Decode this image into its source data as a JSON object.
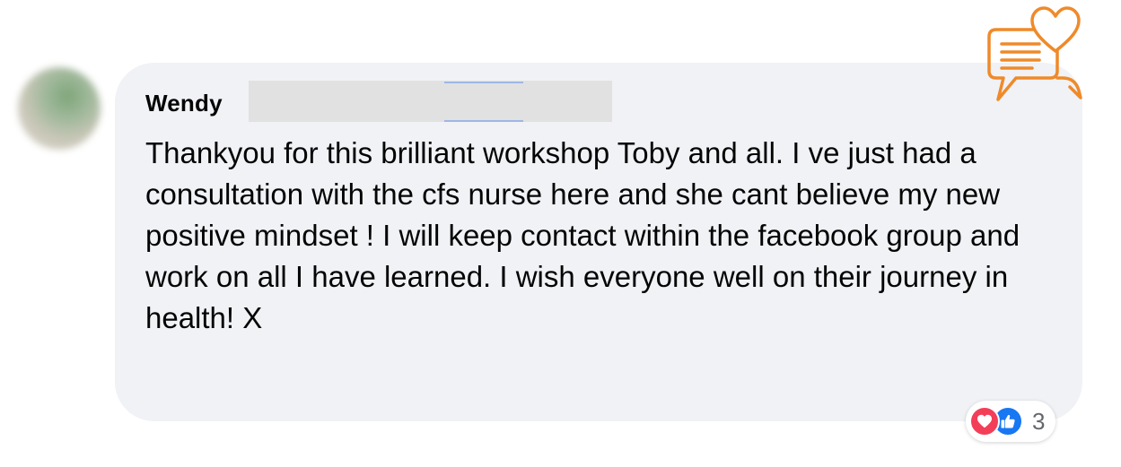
{
  "comment": {
    "author": "Wendy",
    "text": "Thankyou for this brilliant workshop Toby and all. I ve just had a consultation with the cfs nurse here and she cant believe my new positive mindset ! I will keep contact within the facebook group and work on all I have learned. I wish everyone well on their journey in health! X"
  },
  "reactions": {
    "count": "3",
    "types": [
      "love",
      "like"
    ]
  },
  "icons": {
    "decoration": "chat-heart-icon",
    "love": "heart-icon",
    "like": "thumbs-up-icon"
  },
  "colors": {
    "bubble": "#f0f2f5",
    "text": "#050505",
    "love": "#f33e58",
    "like": "#1877f2",
    "accent_orange": "#ef8a2a",
    "muted": "#65676b"
  }
}
